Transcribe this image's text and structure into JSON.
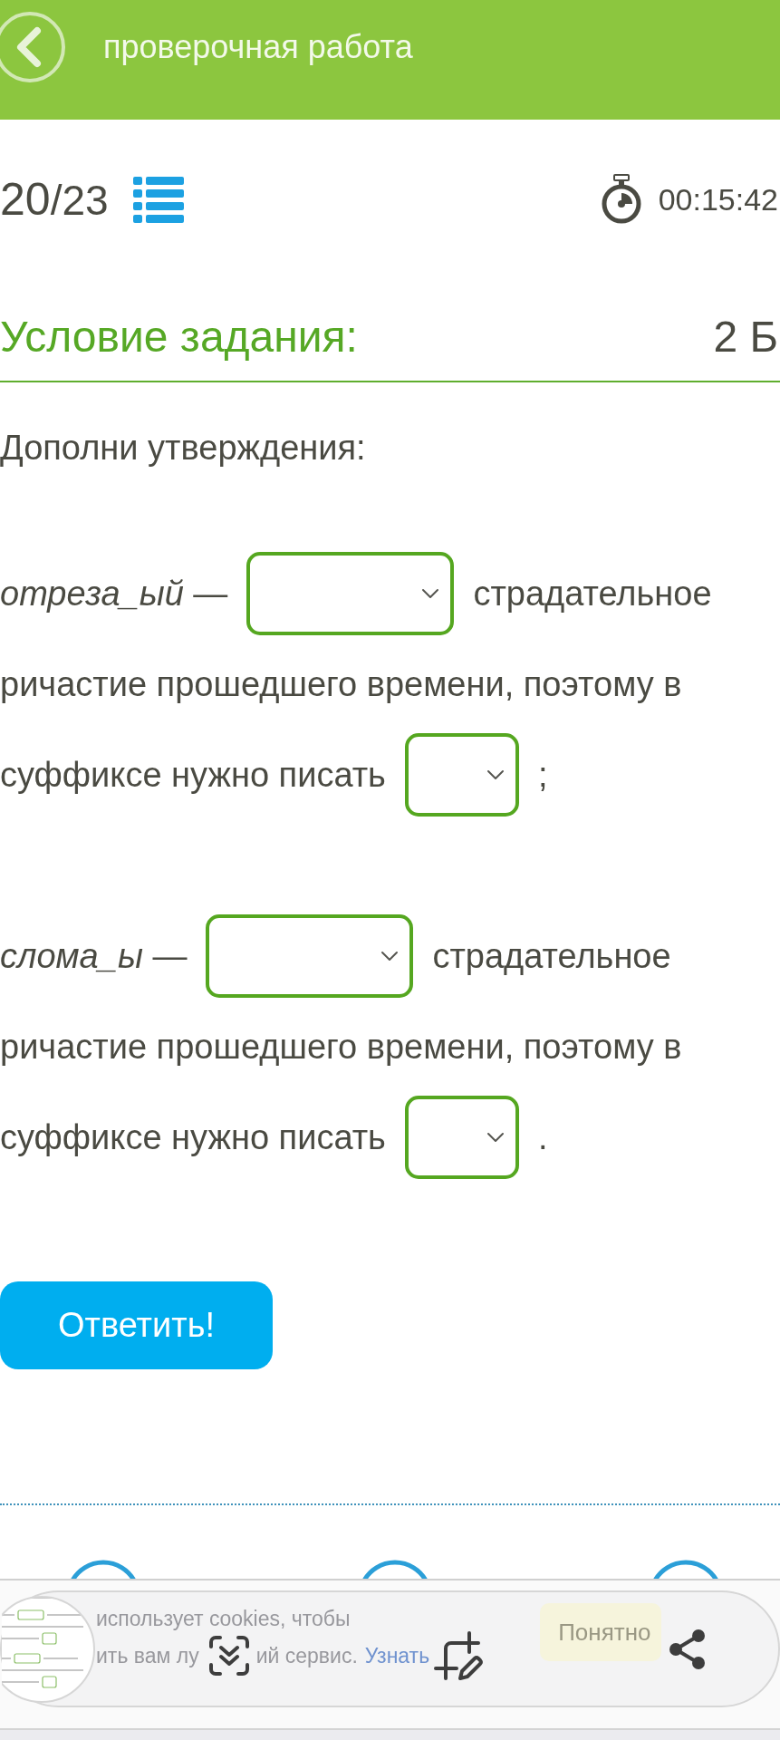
{
  "header": {
    "title": "проверочная работа"
  },
  "progress": {
    "current": "20",
    "total": "/23"
  },
  "timer": {
    "time": "00:15:42"
  },
  "task": {
    "heading": "Условие задания:",
    "points": "2 Б",
    "instruction": "Дополни утверждения:"
  },
  "statements": [
    {
      "lines": [
        {
          "parts": [
            {
              "kind": "text",
              "text": "*отреза_ый* —"
            },
            {
              "kind": "form_select"
            },
            {
              "kind": "text",
              "text": "страдательное"
            }
          ]
        },
        {
          "parts": [
            {
              "kind": "text",
              "text": "ричастие прошедшего времени, поэтому в"
            }
          ]
        },
        {
          "parts": [
            {
              "kind": "text",
              "text": "суффиксе нужно писать"
            },
            {
              "kind": "letter_select"
            },
            {
              "kind": "text",
              "text": ";"
            }
          ]
        }
      ]
    },
    {
      "lines": [
        {
          "parts": [
            {
              "kind": "text",
              "text": "*слома_ы* —"
            },
            {
              "kind": "form_select"
            },
            {
              "kind": "text",
              "text": "страдательное"
            }
          ]
        },
        {
          "parts": [
            {
              "kind": "text",
              "text": "ричастие прошедшего времени, поэтому в"
            }
          ]
        },
        {
          "parts": [
            {
              "kind": "text",
              "text": "суффиксе нужно писать"
            },
            {
              "kind": "letter_select"
            },
            {
              "kind": "text",
              "text": "."
            }
          ]
        }
      ]
    }
  ],
  "submit_button": {
    "label": "Ответить!"
  },
  "cookie_banner": {
    "line_1": "использует cookies, чтобы",
    "line_2_start": "ить вам лу",
    "line_2_end": "ий сервис.",
    "link": "Узнать",
    "button": "Понятно"
  }
}
